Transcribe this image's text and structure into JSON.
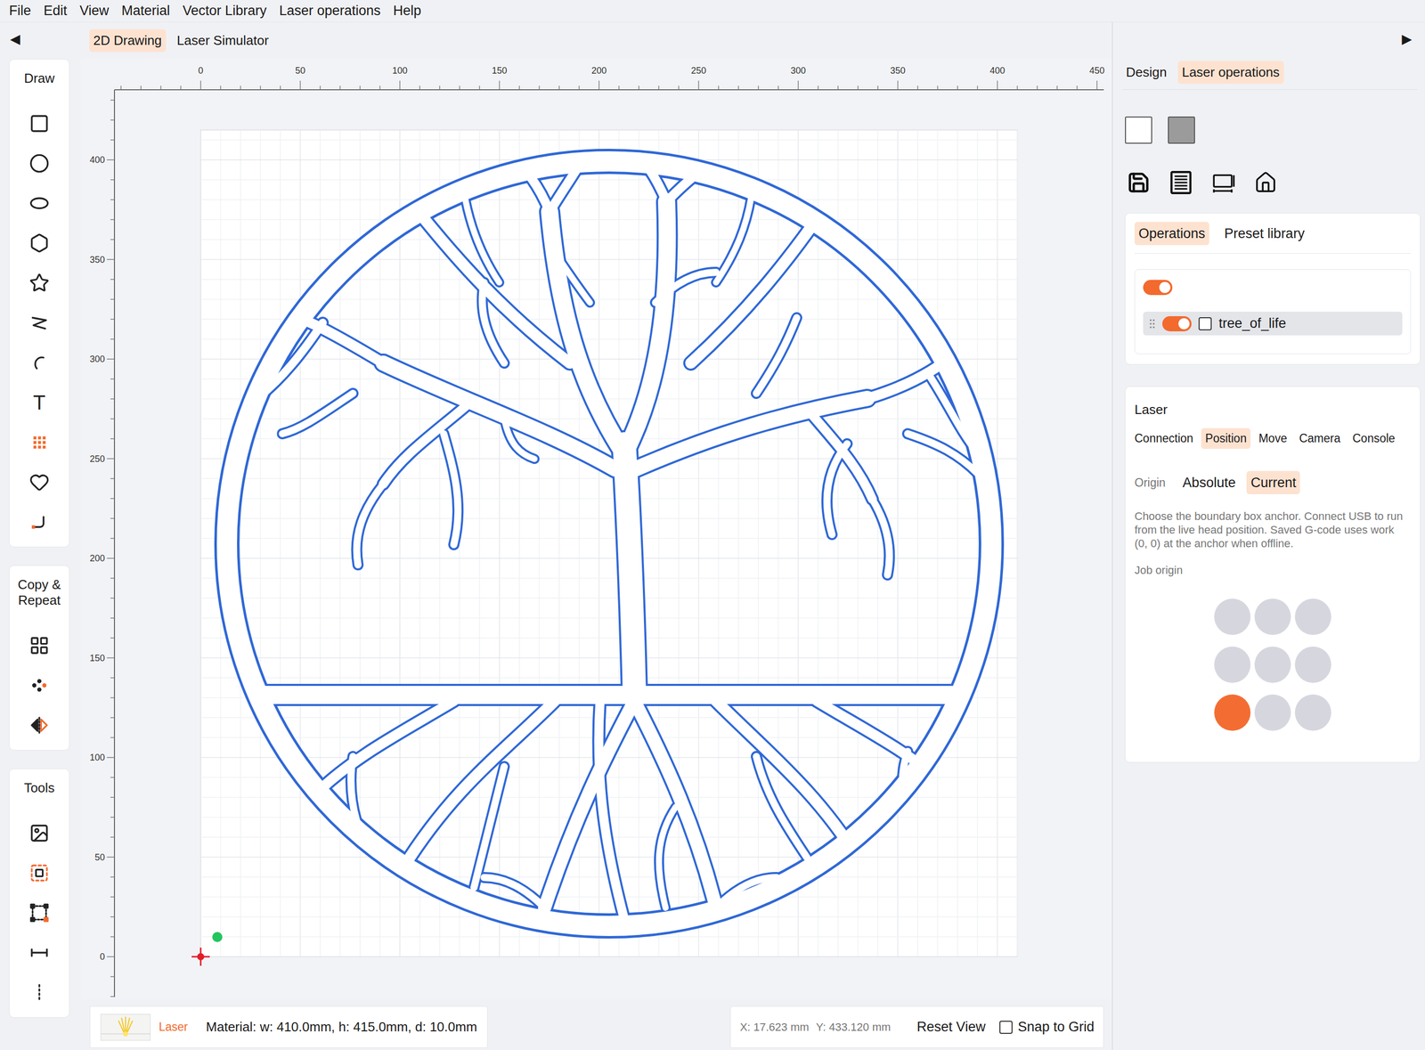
{
  "menu": [
    "File",
    "Edit",
    "View",
    "Material",
    "Vector Library",
    "Laser operations",
    "Help"
  ],
  "left_panel": {
    "collapse": "◀",
    "groups": [
      {
        "title": "Draw",
        "tools": [
          {
            "kind": "rectangle",
            "selected": false
          },
          {
            "kind": "circle",
            "selected": false
          },
          {
            "kind": "ellipse",
            "selected": false
          },
          {
            "kind": "polygon",
            "selected": false
          },
          {
            "kind": "star",
            "selected": false
          },
          {
            "kind": "polyline",
            "selected": false
          },
          {
            "kind": "arc",
            "selected": false
          },
          {
            "kind": "text",
            "label": "T",
            "selected": false
          },
          {
            "kind": "array",
            "selected": true
          },
          {
            "kind": "heart",
            "selected": false
          },
          {
            "kind": "bezier",
            "selected": false
          }
        ]
      },
      {
        "title": "Copy & Repeat",
        "tools": [
          {
            "kind": "grid",
            "selected": false
          },
          {
            "kind": "scatter",
            "selected": false
          },
          {
            "kind": "mirror",
            "selected": false
          }
        ]
      },
      {
        "title": "Tools",
        "tools": [
          {
            "kind": "image",
            "selected": false
          },
          {
            "kind": "outline",
            "selected": true
          },
          {
            "kind": "frame",
            "selected": false
          },
          {
            "kind": "measure",
            "selected": false
          },
          {
            "kind": "more",
            "selected": false
          }
        ]
      }
    ]
  },
  "canvas": {
    "tabs": [
      {
        "label": "2D Drawing",
        "selected": true
      },
      {
        "label": "Laser Simulator",
        "selected": false
      }
    ],
    "ruler_x": [
      "0",
      "50",
      "100",
      "150",
      "200",
      "250",
      "300",
      "350",
      "400",
      "450"
    ],
    "ruler_y": [
      "0",
      "50",
      "100",
      "150",
      "200",
      "250",
      "300",
      "350",
      "400"
    ]
  },
  "status_bar": {
    "mode": "Laser",
    "material": "Material: w: 410.0mm, h: 415.0mm, d: 10.0mm",
    "cursor_x": "X: 17.623 mm",
    "cursor_y": "Y: 433.120 mm",
    "reset": "Reset View",
    "snap": {
      "label": "Snap to Grid",
      "checked": false
    }
  },
  "right_panel": {
    "collapse": "▶",
    "tabs": [
      {
        "label": "Design",
        "selected": false
      },
      {
        "label": "Laser operations",
        "selected": true
      }
    ],
    "operations": {
      "tabs": [
        {
          "label": "Operations",
          "selected": true
        },
        {
          "label": "Preset library",
          "selected": false
        }
      ],
      "group_enabled": true,
      "layers": [
        {
          "name": "tree_of_life",
          "enabled": true,
          "checked": false,
          "selected": true
        }
      ]
    },
    "laser": {
      "title": "Laser",
      "tabs": [
        {
          "label": "Connection",
          "selected": false
        },
        {
          "label": "Position",
          "selected": true
        },
        {
          "label": "Move",
          "selected": false
        },
        {
          "label": "Camera",
          "selected": false
        },
        {
          "label": "Console",
          "selected": false
        }
      ],
      "origin_label": "Origin",
      "origin_modes": [
        {
          "label": "Absolute",
          "selected": false
        },
        {
          "label": "Current",
          "selected": true
        }
      ],
      "description": "Choose the boundary box anchor. Connect USB to run from the live head position. Saved G-code uses work (0, 0) at the anchor when offline.",
      "job_origin_label": "Job origin",
      "anchors": [
        {
          "selected": false
        },
        {
          "selected": false
        },
        {
          "selected": false
        },
        {
          "selected": false
        },
        {
          "selected": false
        },
        {
          "selected": false
        },
        {
          "selected": true
        },
        {
          "selected": false
        },
        {
          "selected": false
        }
      ]
    }
  }
}
